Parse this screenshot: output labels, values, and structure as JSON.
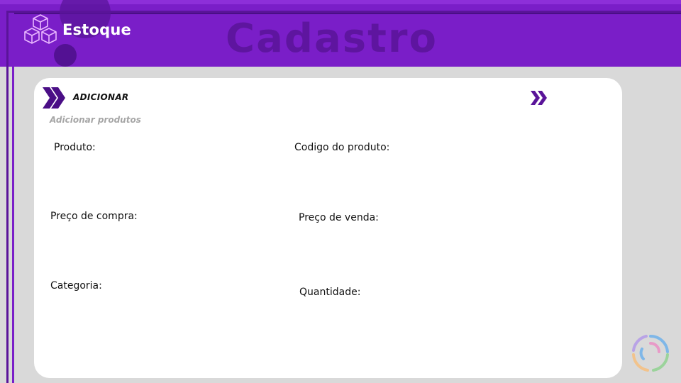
{
  "header": {
    "brand": "Estoque",
    "heading": "Cadastro"
  },
  "section": {
    "title": "ADICIONAR",
    "subtitle": "Adicionar produtos"
  },
  "form": {
    "fields": [
      {
        "label": "Produto:"
      },
      {
        "label": "Codigo do produto:"
      },
      {
        "label": "Preço de compra:"
      },
      {
        "label": "Preço de venda:"
      },
      {
        "label": "Categoria:"
      },
      {
        "label": "Quantidade:"
      }
    ]
  },
  "icons": {
    "brand": "boxes-icon",
    "section_left": "double-chevron-right-icon",
    "section_right": "double-chevron-right-icon",
    "loader": "loading-ring-icon"
  },
  "colors": {
    "header_bg": "#7a1ec8",
    "accent_dark": "#5a1499",
    "page_bg": "#d9d9d9",
    "card_bg": "#ffffff"
  }
}
